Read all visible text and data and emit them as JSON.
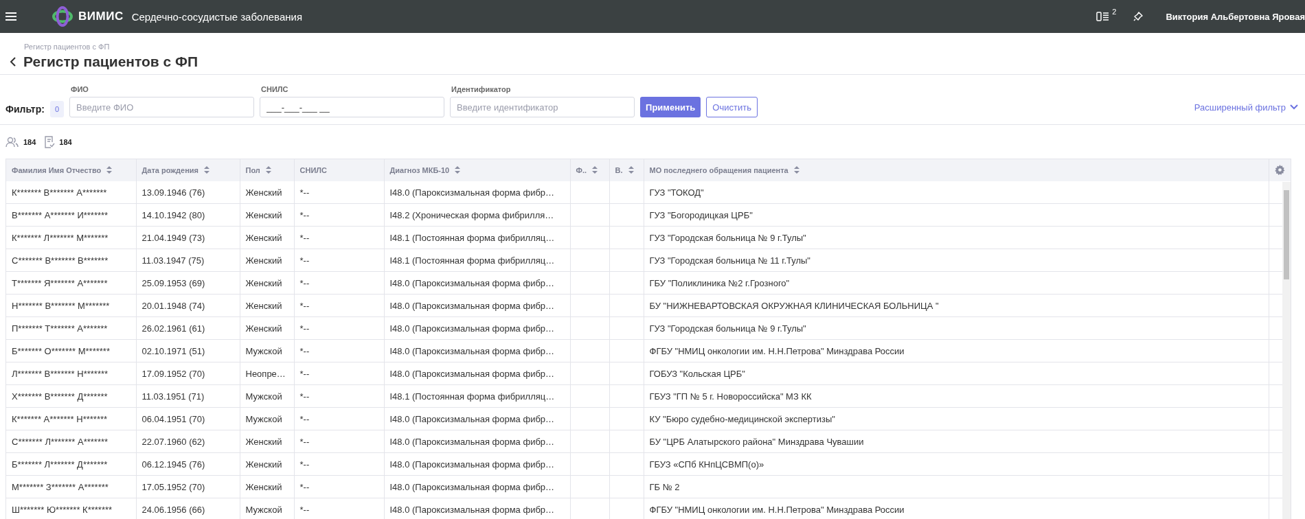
{
  "topbar": {
    "logo_text": "ВИМИС",
    "app_title": "Сердечно-сосудистые заболевания",
    "tasks_count": "2",
    "user_name": "Виктория Альбертовна Яровая"
  },
  "breadcrumb": "Регистр пациентов с ФП",
  "page_title": "Регистр пациентов с ФП",
  "filter": {
    "label": "Фильтр:",
    "count": "0",
    "fields": [
      {
        "label": "ФИО",
        "placeholder": "Введите ФИО"
      },
      {
        "label": "СНИЛС",
        "value": "___-___-___ __"
      },
      {
        "label": "Идентификатор",
        "placeholder": "Введите идентификатор"
      }
    ],
    "apply": "Применить",
    "clear": "Очистить",
    "advanced": "Расширенный фильтр"
  },
  "counts": {
    "patients": "184",
    "records": "184"
  },
  "table": {
    "columns": [
      {
        "label": "Фамилия Имя Отчество",
        "sortable": true
      },
      {
        "label": "Дата рождения",
        "sortable": true
      },
      {
        "label": "Пол",
        "sortable": true
      },
      {
        "label": "СНИЛС",
        "sortable": false
      },
      {
        "label": "Диагноз МКБ-10",
        "sortable": true
      },
      {
        "label": "Ф..",
        "sortable": true
      },
      {
        "label": "В.",
        "sortable": true
      },
      {
        "label": "МО последнего обращения пациента",
        "sortable": true
      }
    ],
    "rows": [
      [
        "К******* В******* А*******",
        "13.09.1946 (76)",
        "Женский",
        "*--",
        "I48.0 (Пароксизмальная форма фибр…",
        "",
        "",
        "ГУЗ \"ТОКОД\""
      ],
      [
        "В******* А******* И*******",
        "14.10.1942 (80)",
        "Женский",
        "*--",
        "I48.2 (Хроническая форма фибрилля…",
        "",
        "",
        "ГУЗ \"Богородицкая ЦРБ\""
      ],
      [
        "К******* Л******* М*******",
        "21.04.1949 (73)",
        "Женский",
        "*--",
        "I48.1 (Постоянная форма фибрилляц…",
        "",
        "",
        "ГУЗ \"Городская больница № 9 г.Тулы\""
      ],
      [
        "С******* В******* В*******",
        "11.03.1947 (75)",
        "Женский",
        "*--",
        "I48.1 (Постоянная форма фибрилляц…",
        "",
        "",
        "ГУЗ \"Городская больница № 11 г.Тулы\""
      ],
      [
        "Т******* Я******* А*******",
        "25.09.1953 (69)",
        "Женский",
        "*--",
        "I48.0 (Пароксизмальная форма фибр…",
        "",
        "",
        "ГБУ \"Поликлиника №2 г.Грозного\""
      ],
      [
        "Н******* В******* М*******",
        "20.01.1948 (74)",
        "Женский",
        "*--",
        "I48.0 (Пароксизмальная форма фибр…",
        "",
        "",
        "БУ \"НИЖНЕВАРТОВСКАЯ ОКРУЖНАЯ КЛИНИЧЕСКАЯ БОЛЬНИЦА \""
      ],
      [
        "П******* Т******* А*******",
        "26.02.1961 (61)",
        "Женский",
        "*--",
        "I48.0 (Пароксизмальная форма фибр…",
        "",
        "",
        "ГУЗ \"Городская больница № 9 г.Тулы\""
      ],
      [
        "Б******* О******* М*******",
        "02.10.1971 (51)",
        "Мужской",
        "*--",
        "I48.0 (Пароксизмальная форма фибр…",
        "",
        "",
        "ФГБУ \"НМИЦ онкологии им. Н.Н.Петрова\" Минздрава России"
      ],
      [
        "Л******* В******* Н*******",
        "17.09.1952 (70)",
        "Неопре…",
        "*--",
        "I48.0 (Пароксизмальная форма фибр…",
        "",
        "",
        "ГОБУЗ \"Кольская ЦРБ\""
      ],
      [
        "Х******* В******* Д*******",
        "11.03.1951 (71)",
        "Мужской",
        "*--",
        "I48.1 (Постоянная форма фибрилляц…",
        "",
        "",
        "ГБУЗ \"ГП № 5 г. Новороссийска\" МЗ КК"
      ],
      [
        "К******* А******* Н*******",
        "06.04.1951 (70)",
        "Мужской",
        "*--",
        "I48.0 (Пароксизмальная форма фибр…",
        "",
        "",
        "КУ \"Бюро судебно-медицинской экспертизы\""
      ],
      [
        "С******* Л******* А*******",
        "22.07.1960 (62)",
        "Женский",
        "*--",
        "I48.0 (Пароксизмальная форма фибр…",
        "",
        "",
        "БУ \"ЦРБ Алатырского района\" Минздрава Чувашии"
      ],
      [
        "Б******* Л******* Д*******",
        "06.12.1945 (76)",
        "Женский",
        "*--",
        "I48.0 (Пароксизмальная форма фибр…",
        "",
        "",
        "ГБУЗ «СПб КНпЦСВМП(о)»"
      ],
      [
        "М******* З******* А*******",
        "17.05.1952 (70)",
        "Женский",
        "*--",
        "I48.0 (Пароксизмальная форма фибр…",
        "",
        "",
        "ГБ № 2"
      ],
      [
        "Ш******* Ю******* К*******",
        "24.06.1956 (66)",
        "Мужской",
        "*--",
        "I48.0 (Пароксизмальная форма фибр…",
        "",
        "",
        "ФГБУ \"НМИЦ онкологии им. Н.Н.Петрова\" Минздрава России"
      ]
    ]
  }
}
